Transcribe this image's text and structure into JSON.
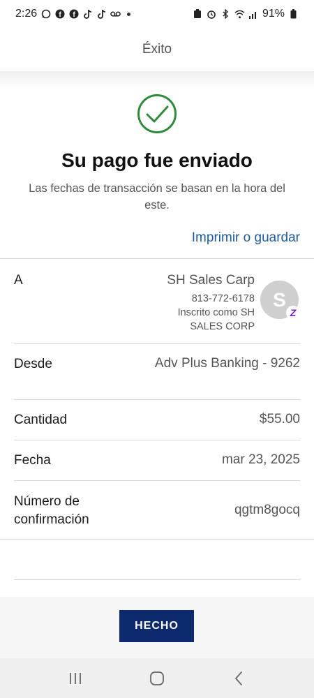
{
  "status_bar": {
    "time": "2:26",
    "battery": "91%"
  },
  "header": {
    "title": "Éxito"
  },
  "success": {
    "headline": "Su pago fue enviado",
    "subtext": "Las fechas de transacción se basan en la hora del este."
  },
  "print_link": "Imprimir o guardar",
  "details": {
    "to": {
      "label": "A",
      "name": "SH Sales Carp",
      "phone": "813-772-6178",
      "enrolled_line1": "Inscrito como SH",
      "enrolled_line2": "SALES CORP",
      "avatar_initial": "S",
      "badge": "Z"
    },
    "from": {
      "label": "Desde",
      "value": "Adv Plus Banking - 9262"
    },
    "amount": {
      "label": "Cantidad",
      "value": "$55.00"
    },
    "date": {
      "label": "Fecha",
      "value": "mar 23, 2025"
    },
    "confirmation": {
      "label_line1": "Número de",
      "label_line2": "confirmación",
      "value": "qgtm8gocq"
    }
  },
  "done_button": "HECHO",
  "colors": {
    "success_green": "#2e8b3a",
    "link_blue": "#1d5b9c",
    "button_navy": "#0d2a6e",
    "zelle_purple": "#6d1ed4"
  },
  "icons": {
    "status": [
      "whatsapp-icon",
      "facebook-icon",
      "facebook-icon",
      "tiktok-icon",
      "tiktok-icon",
      "voicemail-icon"
    ],
    "status_right": [
      "battery-saver-icon",
      "alarm-icon",
      "bluetooth-icon",
      "wifi-icon",
      "signal-icon",
      "battery-icon"
    ],
    "nav": [
      "recent-apps-icon",
      "home-icon",
      "back-icon"
    ]
  }
}
